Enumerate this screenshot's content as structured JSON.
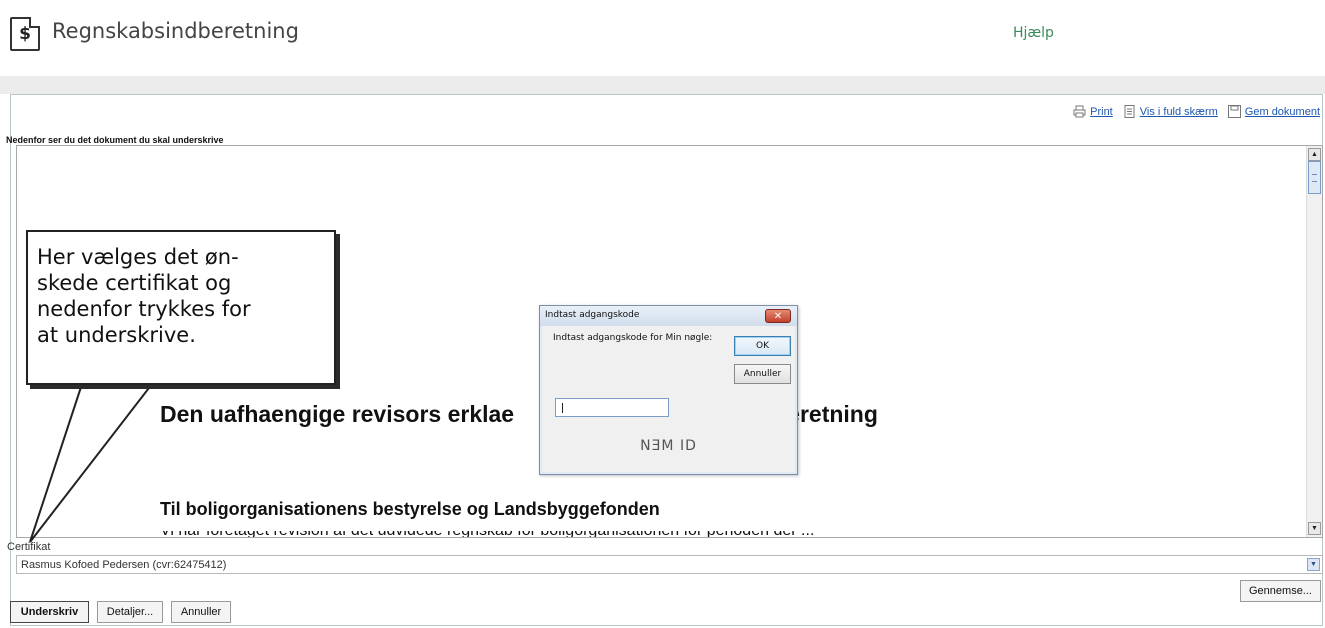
{
  "header": {
    "app_icon_glyph": "$",
    "title": "Regnskabsindberetning",
    "help_link": "Hjælp"
  },
  "toolbar": {
    "print": "Print",
    "fullscreen": "Vis i fuld skærm",
    "save_document": "Gem dokument"
  },
  "document": {
    "caption": "Nedenfor ser du det dokument du skal underskrive",
    "heading_left": "Den uafhaengige revisors erklae",
    "heading_right": "beretning",
    "subheading": "Til boligorganisationens bestyrelse og Landsbyggefonden"
  },
  "certificate": {
    "label": "Certifikat",
    "selected": "Rasmus Kofoed Pedersen (cvr:62475412)",
    "browse_button": "Gennemse..."
  },
  "actions": {
    "sign": "Underskriv",
    "details": "Detaljer...",
    "cancel": "Annuller"
  },
  "dialog": {
    "title": "Indtast adgangskode",
    "prompt": "Indtast adgangskode for Min nøgle:",
    "ok": "OK",
    "cancel": "Annuller",
    "close_glyph": "✕",
    "password_value": "",
    "logo": "NƎM ID"
  },
  "callout": {
    "text": "Her vælges det øn-\nskede certifikat og\nnedenfor trykkes for\nat underskrive."
  },
  "icons": {
    "app": "dollar-document-icon",
    "print": "printer-icon",
    "fullscreen": "page-icon",
    "save": "save-icon",
    "dropdown": "chevron-down-icon",
    "scroll_up": "arrow-up-icon",
    "scroll_down": "arrow-down-icon",
    "close": "close-icon"
  }
}
